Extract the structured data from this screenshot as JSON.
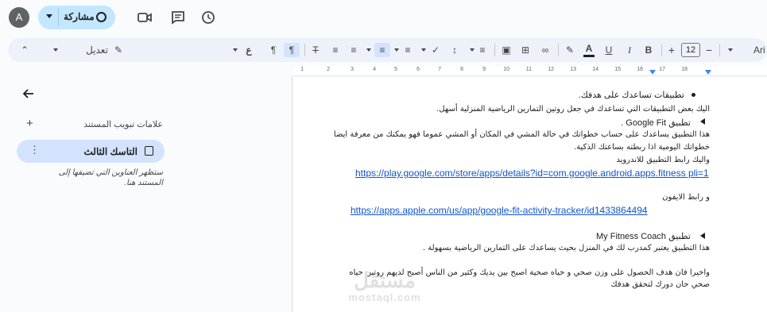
{
  "topbar": {
    "avatar_letter": "A",
    "share_label": "مشاركة"
  },
  "toolbar": {
    "font_partial": "Ari",
    "font_size": "12",
    "bold": "B",
    "italic": "I",
    "underline": "U",
    "text_color": "A",
    "mode_label": "تعديل",
    "ltr_glyph": "ع"
  },
  "ruler": {
    "ticks": [
      "1",
      "2",
      "3",
      "4",
      "5",
      "6",
      "7",
      "8",
      "9",
      "10",
      "11",
      "12",
      "13",
      "14",
      "15",
      "16",
      "17",
      "18"
    ]
  },
  "sidebar": {
    "title": "علامات تبويب المستند",
    "tab_name": "التاسك الثالث",
    "hint": "ستظهر العناوين التي تضيفها إلى المستند هنا."
  },
  "document": {
    "lines": [
      "تطبيقات تساعدك على هدفك.",
      "اليك بعض التطبيقات التي تساعدك في جعل روتين التمارين الرياضية المنزلية أسهل.",
      "تطبيق Google Fit .",
      "هذا التطبيق يساعدك على حساب خطواتك في حالة المشي في المكان أو المشي عموما فهو يمكنك من معرفة ايضا",
      "خطواتك اليومية اذا ربطته بساعتك الذكية.",
      "واليك رابط التطبيق للاندرويد",
      "https://play.google.com/store/apps/details?id=com.google.android.apps.fitness pli=1",
      "و رابط الايفون",
      "https://apps.apple.com/us/app/google-fit-activity-tracker/id1433864494",
      "تطبيق My Fitness Coach",
      "هذا التطبيق يعتبر كمدرب لك في المنزل بحيث يساعدك على التمارين الرياضية بسهولة .",
      "واخيرا فان هدف الحصول على وزن صحي و حياه صحية اصبح بين يديك وكثير من الناس أصبح لديهم روتين حياه",
      "صحي حان دورك لتحقق هدفك"
    ]
  },
  "watermark": {
    "arabic": "مستقل",
    "latin": "mostaql.com"
  },
  "colors": {
    "accent": "#c2e7ff",
    "tab_selected": "#d3e3fd",
    "link": "#1155cc"
  }
}
